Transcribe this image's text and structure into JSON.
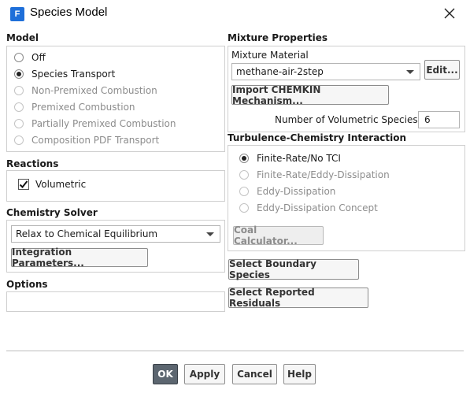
{
  "window": {
    "title": "Species Model",
    "app_icon_letter": "F"
  },
  "model": {
    "label": "Model",
    "options": [
      {
        "label": "Off",
        "selected": false,
        "enabled": true
      },
      {
        "label": "Species Transport",
        "selected": true,
        "enabled": true
      },
      {
        "label": "Non-Premixed Combustion",
        "selected": false,
        "enabled": false
      },
      {
        "label": "Premixed Combustion",
        "selected": false,
        "enabled": false
      },
      {
        "label": "Partially Premixed Combustion",
        "selected": false,
        "enabled": false
      },
      {
        "label": "Composition PDF Transport",
        "selected": false,
        "enabled": false
      }
    ]
  },
  "reactions": {
    "label": "Reactions",
    "volumetric_label": "Volumetric",
    "volumetric_checked": true
  },
  "chemistry_solver": {
    "label": "Chemistry Solver",
    "selected": "Relax to Chemical Equilibrium",
    "integration_button": "Integration Parameters..."
  },
  "options": {
    "label": "Options"
  },
  "mixture": {
    "label": "Mixture Properties",
    "material_label": "Mixture Material",
    "material_value": "methane-air-2step",
    "edit_button": "Edit...",
    "import_button": "Import CHEMKIN Mechanism...",
    "num_species_label": "Number of Volumetric Species",
    "num_species_value": "6"
  },
  "tci": {
    "label": "Turbulence-Chemistry Interaction",
    "options": [
      {
        "label": "Finite-Rate/No TCI",
        "selected": true,
        "enabled": true
      },
      {
        "label": "Finite-Rate/Eddy-Dissipation",
        "selected": false,
        "enabled": false
      },
      {
        "label": "Eddy-Dissipation",
        "selected": false,
        "enabled": false
      },
      {
        "label": "Eddy-Dissipation Concept",
        "selected": false,
        "enabled": false
      }
    ],
    "coal_button": "Coal Calculator..."
  },
  "select_boundary_button": "Select Boundary Species",
  "select_residuals_button": "Select Reported Residuals",
  "footer": {
    "ok": "OK",
    "apply": "Apply",
    "cancel": "Cancel",
    "help": "Help"
  }
}
